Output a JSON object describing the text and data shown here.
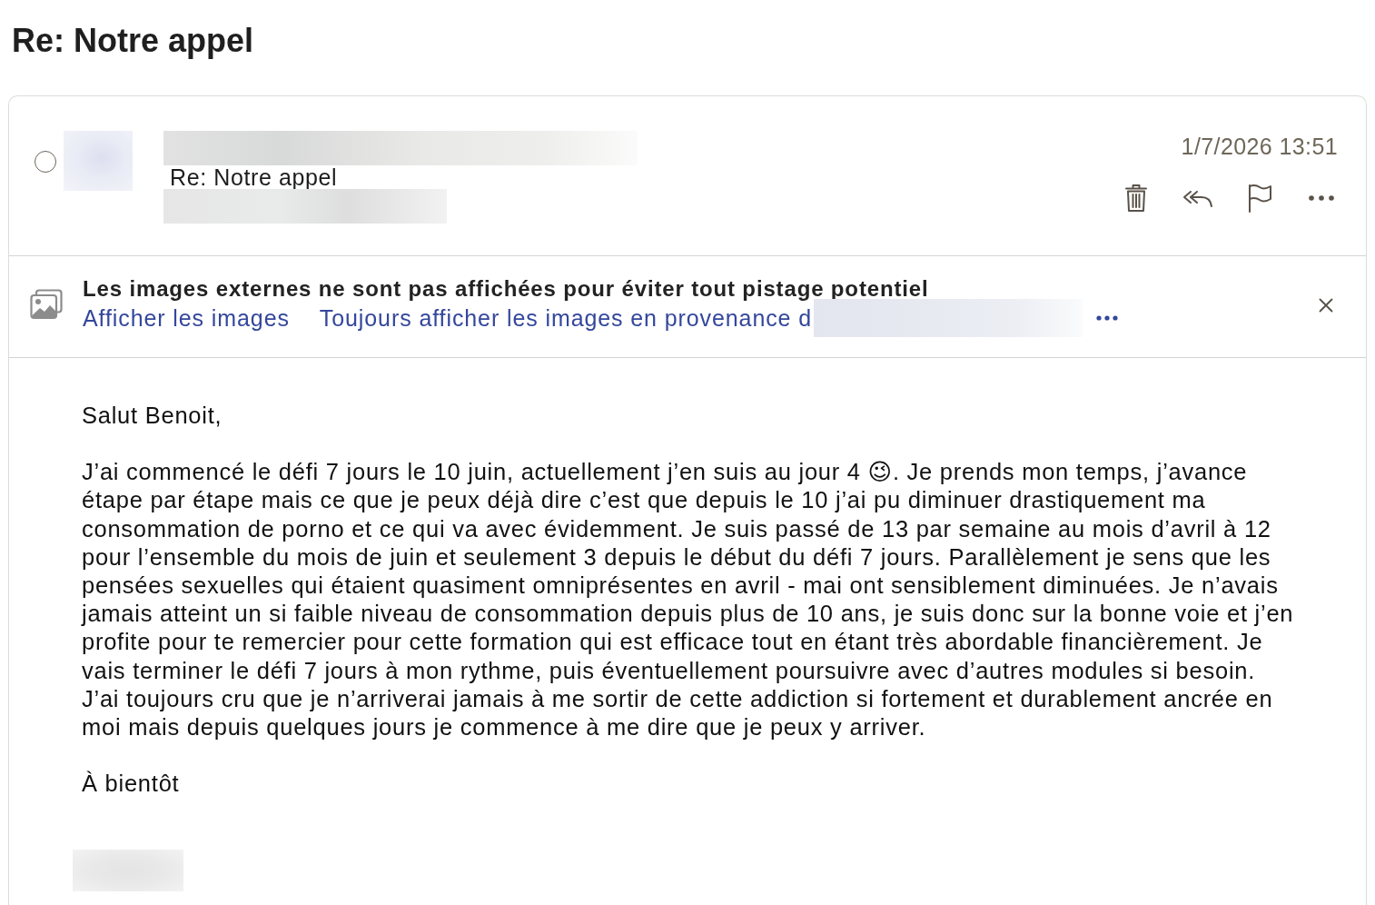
{
  "page_title": "Re: Notre appel",
  "message": {
    "selected": false,
    "subject": "Re: Notre appel",
    "date": "1/7/2026 13:51"
  },
  "image_notice": {
    "text": "Les images externes ne sont pas affichées pour éviter tout pistage potentiel",
    "links": [
      "Afficher les images",
      "Toujours afficher les images en provenance d"
    ]
  },
  "body": {
    "greeting": "Salut Benoit,",
    "paragraph": "J’ai commencé le défi 7 jours le 10 juin, actuellement j’en suis au jour 4 😉. Je prends mon temps, j’avance étape par étape mais ce que je peux déjà dire c’est que depuis le 10 j’ai pu diminuer drastiquement ma consommation de porno et ce qui va avec évidemment. Je suis passé de 13 par semaine au mois d’avril à 12 pour l’ensemble du mois de juin et seulement 3 depuis le début du défi 7 jours. Parallèlement je sens que les pensées sexuelles qui étaient quasiment omniprésentes en avril - mai ont sensiblement diminuées. Je n’avais jamais atteint un si faible niveau de consommation depuis plus de 10 ans, je suis donc sur la bonne voie et j’en profite pour te remercier pour cette formation qui est efficace tout en étant très abordable financièrement. Je vais terminer le défi 7 jours à mon rythme, puis éventuellement poursuivre avec d’autres modules si besoin. J’ai toujours cru que je n’arriverai jamais à me sortir de cette addiction si fortement et durablement ancrée en moi mais depuis quelques jours je commence à me dire que je peux y arriver.",
    "closing": "À bientôt"
  }
}
